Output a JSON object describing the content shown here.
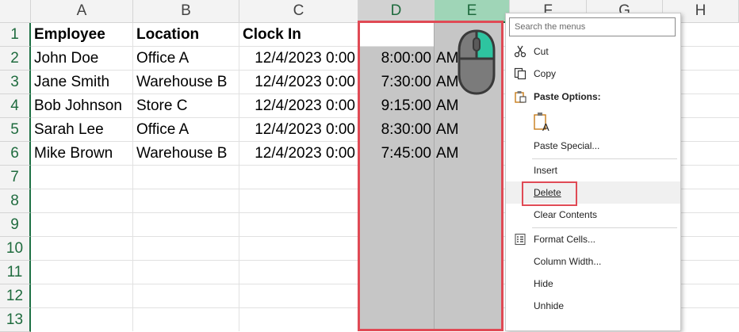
{
  "columns": [
    "A",
    "B",
    "C",
    "D",
    "E",
    "F",
    "G",
    "H"
  ],
  "rows": [
    "1",
    "2",
    "3",
    "4",
    "5",
    "6",
    "7",
    "8",
    "9",
    "10",
    "11",
    "12",
    "13"
  ],
  "sheet": {
    "headers": {
      "employee": "Employee",
      "location": "Location",
      "clock_in": "Clock In"
    },
    "records": [
      {
        "employee": "John Doe",
        "location": "Office A",
        "clock_in": "12/4/2023 0:00",
        "time": "8:00:00",
        "ampm": "AM"
      },
      {
        "employee": "Jane Smith",
        "location": "Warehouse B",
        "clock_in": "12/4/2023 0:00",
        "time": "7:30:00",
        "ampm": "AM"
      },
      {
        "employee": "Bob Johnson",
        "location": "Store C",
        "clock_in": "12/4/2023 0:00",
        "time": "9:15:00",
        "ampm": "AM"
      },
      {
        "employee": "Sarah Lee",
        "location": "Office A",
        "clock_in": "12/4/2023 0:00",
        "time": "8:30:00",
        "ampm": "AM"
      },
      {
        "employee": "Mike Brown",
        "location": "Warehouse B",
        "clock_in": "12/4/2023 0:00",
        "time": "7:45:00",
        "ampm": "AM"
      }
    ]
  },
  "context_menu": {
    "search_placeholder": "Search the menus",
    "cut": "Cut",
    "copy": "Copy",
    "paste_options": "Paste Options:",
    "paste_special": "Paste Special...",
    "insert": "Insert",
    "delete": "Delete",
    "clear_contents": "Clear Contents",
    "format_cells": "Format Cells...",
    "column_width": "Column Width...",
    "hide": "Hide",
    "unhide": "Unhide"
  },
  "colors": {
    "selection_gray": "#c6c6c6",
    "highlight_red": "#e04a55",
    "excel_green": "#1e7145",
    "mouse_accent": "#2ec4a0"
  }
}
